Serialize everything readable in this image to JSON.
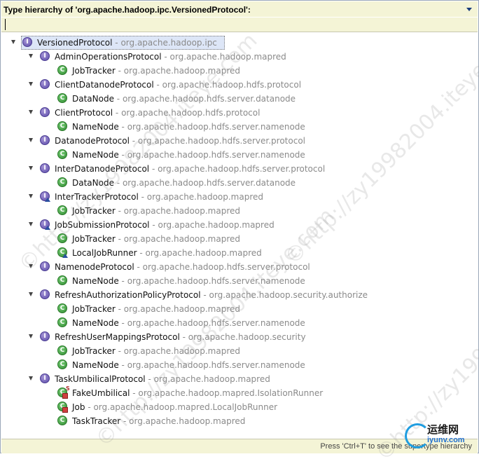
{
  "header": {
    "title": "Type hierarchy of 'org.apache.hadoop.ipc.VersionedProtocol':"
  },
  "filter": {
    "value": ""
  },
  "status": {
    "hint": "Press 'Ctrl+T' to see the supertype hierarchy"
  },
  "watermarks": [
    "©http://zy19982004.iteye.com",
    "©http://zy19982004.iteye.com",
    "©http://zy19982004.iteye.com",
    "©http://zy19982004.iteye.com"
  ],
  "logo": {
    "cn": "运维网",
    "en": "iyunv.com"
  },
  "tree": [
    {
      "level": 0,
      "kind": "interface",
      "name": "VersionedProtocol",
      "pkg": "org.apache.hadoop.ipc",
      "expanded": true,
      "selected": true
    },
    {
      "level": 1,
      "kind": "interface",
      "name": "AdminOperationsProtocol",
      "pkg": "org.apache.hadoop.mapred",
      "expanded": true
    },
    {
      "level": 2,
      "kind": "class",
      "name": "JobTracker",
      "pkg": "org.apache.hadoop.mapred"
    },
    {
      "level": 1,
      "kind": "interface",
      "name": "ClientDatanodeProtocol",
      "pkg": "org.apache.hadoop.hdfs.protocol",
      "expanded": true
    },
    {
      "level": 2,
      "kind": "class",
      "name": "DataNode",
      "pkg": "org.apache.hadoop.hdfs.server.datanode"
    },
    {
      "level": 1,
      "kind": "interface",
      "name": "ClientProtocol",
      "pkg": "org.apache.hadoop.hdfs.protocol",
      "expanded": true
    },
    {
      "level": 2,
      "kind": "class",
      "name": "NameNode",
      "pkg": "org.apache.hadoop.hdfs.server.namenode"
    },
    {
      "level": 1,
      "kind": "interface",
      "name": "DatanodeProtocol",
      "pkg": "org.apache.hadoop.hdfs.server.protocol",
      "expanded": true
    },
    {
      "level": 2,
      "kind": "class",
      "name": "NameNode",
      "pkg": "org.apache.hadoop.hdfs.server.namenode"
    },
    {
      "level": 1,
      "kind": "interface",
      "name": "InterDatanodeProtocol",
      "pkg": "org.apache.hadoop.hdfs.server.protocol",
      "expanded": true
    },
    {
      "level": 2,
      "kind": "class",
      "name": "DataNode",
      "pkg": "org.apache.hadoop.hdfs.server.datanode"
    },
    {
      "level": 1,
      "kind": "interface",
      "name": "InterTrackerProtocol",
      "pkg": "org.apache.hadoop.mapred",
      "expanded": true,
      "overlay": "triangle"
    },
    {
      "level": 2,
      "kind": "class",
      "name": "JobTracker",
      "pkg": "org.apache.hadoop.mapred"
    },
    {
      "level": 1,
      "kind": "interface",
      "name": "JobSubmissionProtocol",
      "pkg": "org.apache.hadoop.mapred",
      "expanded": true,
      "overlay": "triangle"
    },
    {
      "level": 2,
      "kind": "class",
      "name": "JobTracker",
      "pkg": "org.apache.hadoop.mapred"
    },
    {
      "level": 2,
      "kind": "class",
      "name": "LocalJobRunner",
      "pkg": "org.apache.hadoop.mapred",
      "overlay": "triangle"
    },
    {
      "level": 1,
      "kind": "interface",
      "name": "NamenodeProtocol",
      "pkg": "org.apache.hadoop.hdfs.server.protocol",
      "expanded": true
    },
    {
      "level": 2,
      "kind": "class",
      "name": "NameNode",
      "pkg": "org.apache.hadoop.hdfs.server.namenode"
    },
    {
      "level": 1,
      "kind": "interface",
      "name": "RefreshAuthorizationPolicyProtocol",
      "pkg": "org.apache.hadoop.security.authorize",
      "expanded": true
    },
    {
      "level": 2,
      "kind": "class",
      "name": "JobTracker",
      "pkg": "org.apache.hadoop.mapred"
    },
    {
      "level": 2,
      "kind": "class",
      "name": "NameNode",
      "pkg": "org.apache.hadoop.hdfs.server.namenode"
    },
    {
      "level": 1,
      "kind": "interface",
      "name": "RefreshUserMappingsProtocol",
      "pkg": "org.apache.hadoop.security",
      "expanded": true
    },
    {
      "level": 2,
      "kind": "class",
      "name": "JobTracker",
      "pkg": "org.apache.hadoop.mapred"
    },
    {
      "level": 2,
      "kind": "class",
      "name": "NameNode",
      "pkg": "org.apache.hadoop.hdfs.server.namenode"
    },
    {
      "level": 1,
      "kind": "interface",
      "name": "TaskUmbilicalProtocol",
      "pkg": "org.apache.hadoop.mapred",
      "expanded": true
    },
    {
      "level": 2,
      "kind": "class",
      "name": "FakeUmbilical",
      "pkg": "org.apache.hadoop.mapred.IsolationRunner",
      "overlay": "private-static"
    },
    {
      "level": 2,
      "kind": "class",
      "name": "Job",
      "pkg": "org.apache.hadoop.mapred.LocalJobRunner",
      "overlay": "private"
    },
    {
      "level": 2,
      "kind": "class",
      "name": "TaskTracker",
      "pkg": "org.apache.hadoop.mapred"
    }
  ]
}
